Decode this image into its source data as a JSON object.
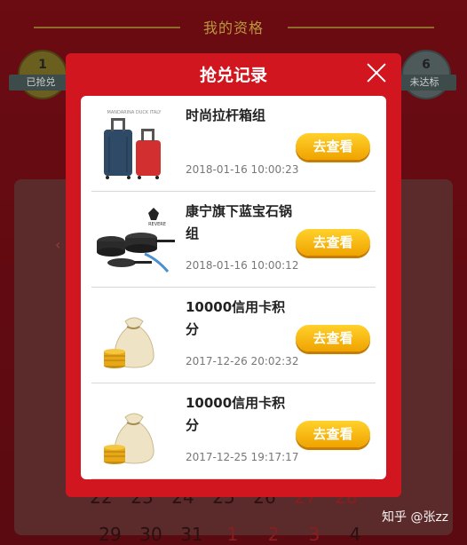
{
  "page": {
    "header_title": "我的资格",
    "badges": [
      {
        "number": "1",
        "label": "已抢兑"
      },
      {
        "number": "6",
        "label": "未达标"
      }
    ]
  },
  "calendar": {
    "row1": [
      "22",
      "23",
      "24",
      "25",
      "26",
      "27",
      "28"
    ],
    "row2": [
      "29",
      "30",
      "31",
      "1",
      "2",
      "3",
      "4"
    ]
  },
  "modal": {
    "title": "抢兑记录",
    "items": [
      {
        "name": "时尚拉杆箱组",
        "time": "2018-01-16 10:00:23",
        "button": "去查看",
        "img_caption": "MANDARINA DUCK ITALY"
      },
      {
        "name": "康宁旗下蓝宝石锅组",
        "time": "2018-01-16 10:00:12",
        "button": "去查看",
        "img_caption": "REVERE"
      },
      {
        "name": "10000信用卡积分",
        "time": "2017-12-26 20:02:32",
        "button": "去查看"
      },
      {
        "name": "10000信用卡积分",
        "time": "2017-12-25 19:17:17",
        "button": "去查看"
      }
    ]
  },
  "watermark": "知乎 @张zz",
  "colors": {
    "modal_red": "#d1161f",
    "button_yellow": "#ffc21a",
    "page_bg": "#5a0a10"
  }
}
